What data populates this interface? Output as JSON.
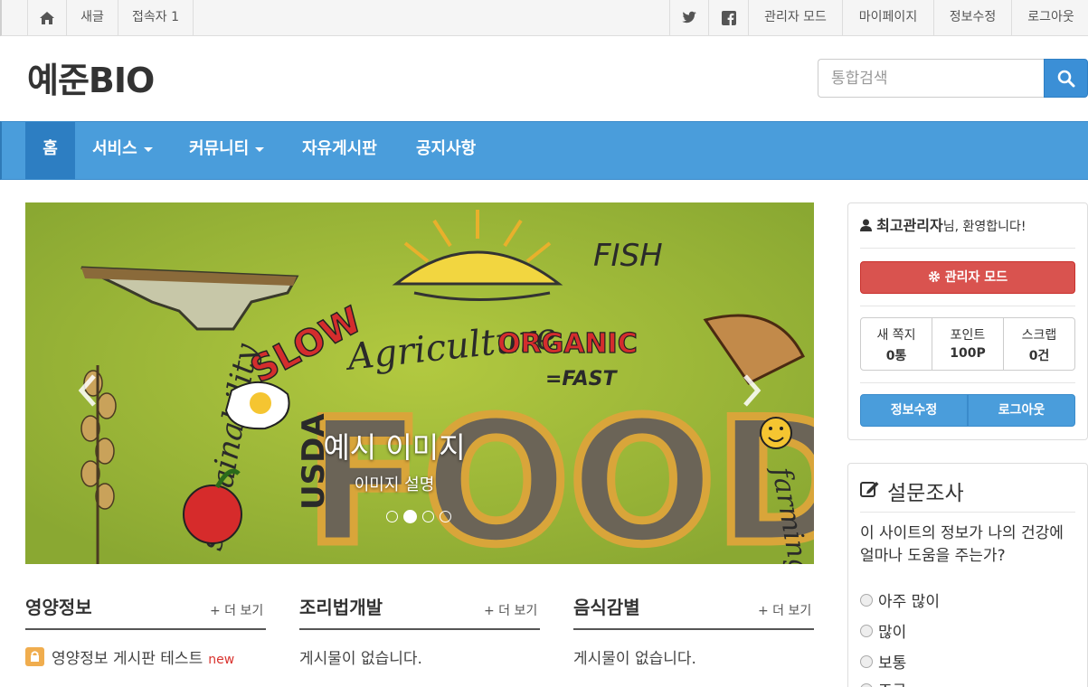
{
  "topbar": {
    "left_items": [
      "새글",
      "접속자 1"
    ],
    "right_items": [
      "관리자 모드",
      "마이페이지",
      "정보수정",
      "로그아웃"
    ]
  },
  "header": {
    "logo": "예준BIO",
    "search_placeholder": "통합검색"
  },
  "nav": {
    "items": [
      {
        "label": "홈"
      },
      {
        "label": "서비스"
      },
      {
        "label": "커뮤니티"
      },
      {
        "label": "자유게시판"
      },
      {
        "label": "공지사항"
      }
    ]
  },
  "carousel": {
    "caption_title": "예시 이미지",
    "caption_desc": "이미지 설명",
    "indicator_count": 4,
    "active_index": 1,
    "image_words": [
      "FISH",
      "SLOW",
      "Agriculture",
      "ORGANIC",
      "=FAST",
      "FOOD",
      "USDA",
      "sustainability",
      "farming"
    ]
  },
  "boards": [
    {
      "title": "영양정보",
      "more": "+ 더 보기",
      "post": "영양정보 게시판 테스트",
      "badge": "new"
    },
    {
      "title": "조리법개발",
      "more": "+ 더 보기",
      "post": "게시물이 없습니다."
    },
    {
      "title": "음식감별",
      "more": "+ 더 보기",
      "post": "게시물이 없습니다."
    }
  ],
  "sidebar": {
    "user_name": "최고관리자",
    "welcome_suffix": "님, 환영합니다!",
    "admin_button": "관리자 모드",
    "stats": [
      {
        "label": "새 쪽지",
        "value": "0통"
      },
      {
        "label": "포인트",
        "value": "100P"
      },
      {
        "label": "스크랩",
        "value": "0건"
      }
    ],
    "edit_button": "정보수정",
    "logout_button": "로그아웃"
  },
  "poll": {
    "title": "설문조사",
    "question": "이 사이트의 정보가 나의 건강에 얼마나 도움을 주는가?",
    "options": [
      "아주 많이",
      "많이",
      "보통",
      "조금"
    ]
  },
  "colors": {
    "nav_bg": "#4a9ddb",
    "nav_active": "#2d7ec2",
    "danger": "#d9534f",
    "new_badge": "#d9332e"
  }
}
